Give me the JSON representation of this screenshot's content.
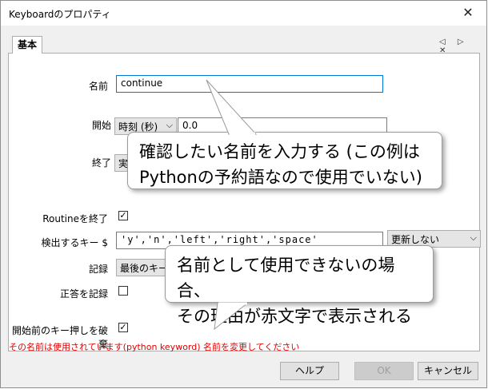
{
  "window": {
    "title": "Keyboardのプロパティ",
    "close_glyph": "✕"
  },
  "tabs": {
    "active": "基本",
    "arrows": "◁ ▷ ✕"
  },
  "form": {
    "name_label": "名前",
    "name_value": "continue",
    "start_label": "開始",
    "start_type": "時刻 (秒)",
    "start_value": "0.0",
    "end_label": "終了",
    "end_type": "実",
    "routine_end_label": "Routineを終了",
    "routine_end_checked": true,
    "keys_label": "検出するキー $",
    "keys_value": "'y','n','left','right','space'",
    "update_value": "更新しない",
    "record_label": "記録",
    "record_value": "最後のキー",
    "correct_label": "正答を記録",
    "correct_checked": false,
    "discard_label": "開始前のキー押しを破棄",
    "discard_checked": true
  },
  "error_message": "その名前は使用されています(python keyword) 名前を変更してください",
  "buttons": {
    "help": "ヘルプ",
    "ok": "OK",
    "cancel": "キャンセル"
  },
  "callouts": {
    "top": {
      "line1": "確認したい名前を入力する (この例は",
      "line2": "Pythonの予約語なので使用でいない)"
    },
    "bottom": {
      "line1": "名前として使用できないの場合、",
      "line2": "その理由が赤文字で表示される"
    }
  },
  "icons": {
    "check": "✓",
    "chevron": "⌵"
  }
}
